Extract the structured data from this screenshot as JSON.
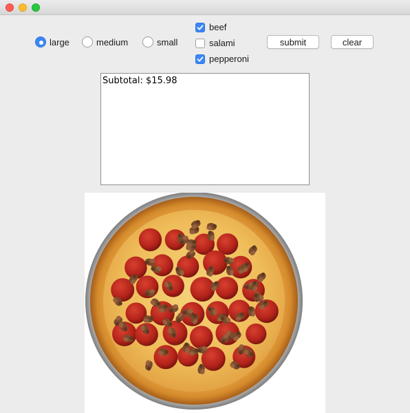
{
  "window": {
    "controls": [
      "close",
      "minimize",
      "zoom"
    ]
  },
  "size": {
    "options": [
      {
        "label": "large",
        "selected": true
      },
      {
        "label": "medium",
        "selected": false
      },
      {
        "label": "small",
        "selected": false
      }
    ]
  },
  "toppings": {
    "options": [
      {
        "label": "beef",
        "checked": true
      },
      {
        "label": "salami",
        "checked": false
      },
      {
        "label": "pepperoni",
        "checked": true
      }
    ]
  },
  "actions": {
    "submit_label": "submit",
    "clear_label": "clear"
  },
  "output": {
    "text": "Subtotal: $15.98"
  },
  "pizza_image": {
    "toppings_shown": [
      "pepperoni",
      "beef"
    ]
  },
  "colors": {
    "accent": "#3b87f7",
    "window_bg": "#ececec"
  }
}
